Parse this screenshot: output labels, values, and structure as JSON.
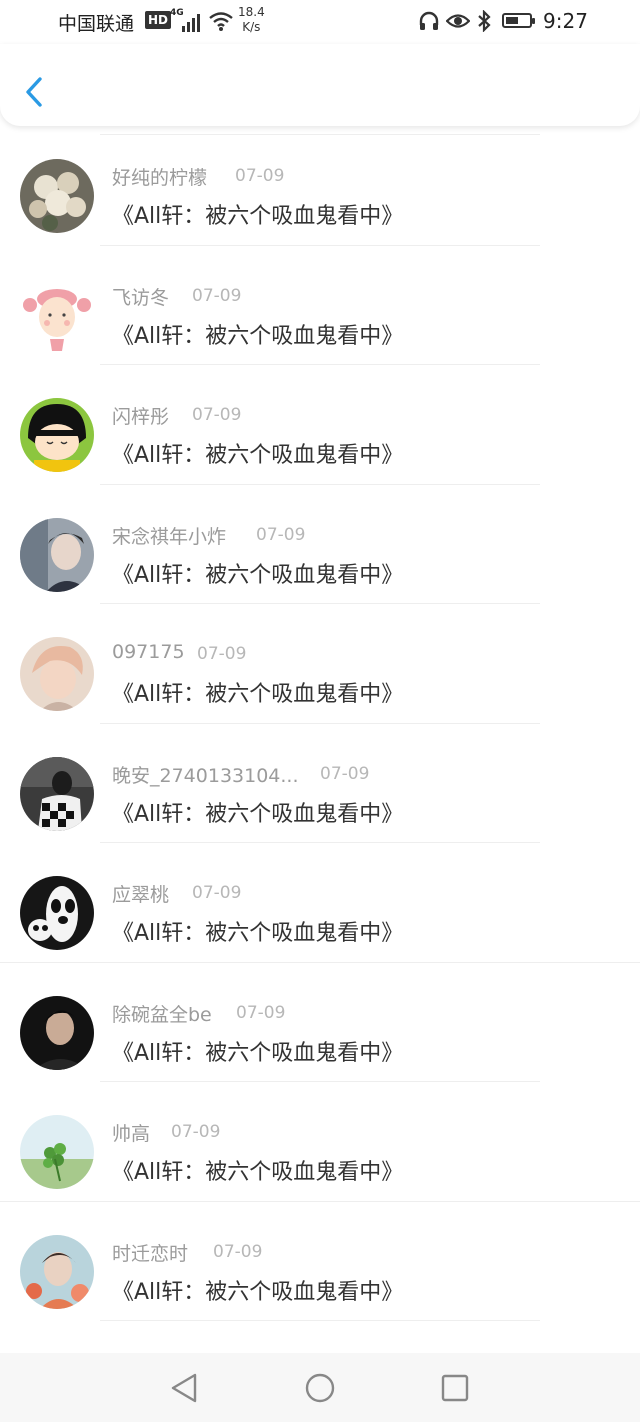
{
  "status": {
    "carrier": "中国联通",
    "hd": "HD",
    "network": "4G",
    "speed_value": "18.4",
    "speed_unit": "K/s",
    "time": "9:27",
    "battery_level": 0.55
  },
  "list": [
    {
      "user": "好纯的柠檬",
      "date": "07-09",
      "title": "《All轩：被六个吸血鬼看中》",
      "avatar": "flower-bouquet"
    },
    {
      "user": "飞访冬",
      "date": "07-09",
      "title": "《All轩：被六个吸血鬼看中》",
      "avatar": "cartoon-girl-pink-hair"
    },
    {
      "user": "闪梓彤",
      "date": "07-09",
      "title": "《All轩：被六个吸血鬼看中》",
      "avatar": "maruko-cartoon"
    },
    {
      "user": "宋念祺年小炸",
      "date": "07-09",
      "title": "《All轩：被六个吸血鬼看中》",
      "avatar": "young-man-photo"
    },
    {
      "user": "097175",
      "date": "07-09",
      "title": "《All轩：被六个吸血鬼看中》",
      "avatar": "blonde-man-photo"
    },
    {
      "user": "晚安_2740133104...",
      "date": "07-09",
      "title": "《All轩：被六个吸血鬼看中》",
      "avatar": "checkered-shirt-photo"
    },
    {
      "user": "应翠桃",
      "date": "07-09",
      "title": "《All轩：被六个吸血鬼看中》",
      "avatar": "panda-doll"
    },
    {
      "user": "除碗盆全be",
      "date": "07-09",
      "title": "《All轩：被六个吸血鬼看中》",
      "avatar": "dark-portrait"
    },
    {
      "user": "帅高",
      "date": "07-09",
      "title": "《All轩：被六个吸血鬼看中》",
      "avatar": "clover-sky"
    },
    {
      "user": "时迁恋时",
      "date": "07-09",
      "title": "《All轩：被六个吸血鬼看中》",
      "avatar": "floral-portrait"
    }
  ],
  "colors": {
    "accent": "#2a9ae4",
    "username": "#9b9b9b",
    "date": "#b7b7b7",
    "title": "#333333"
  }
}
